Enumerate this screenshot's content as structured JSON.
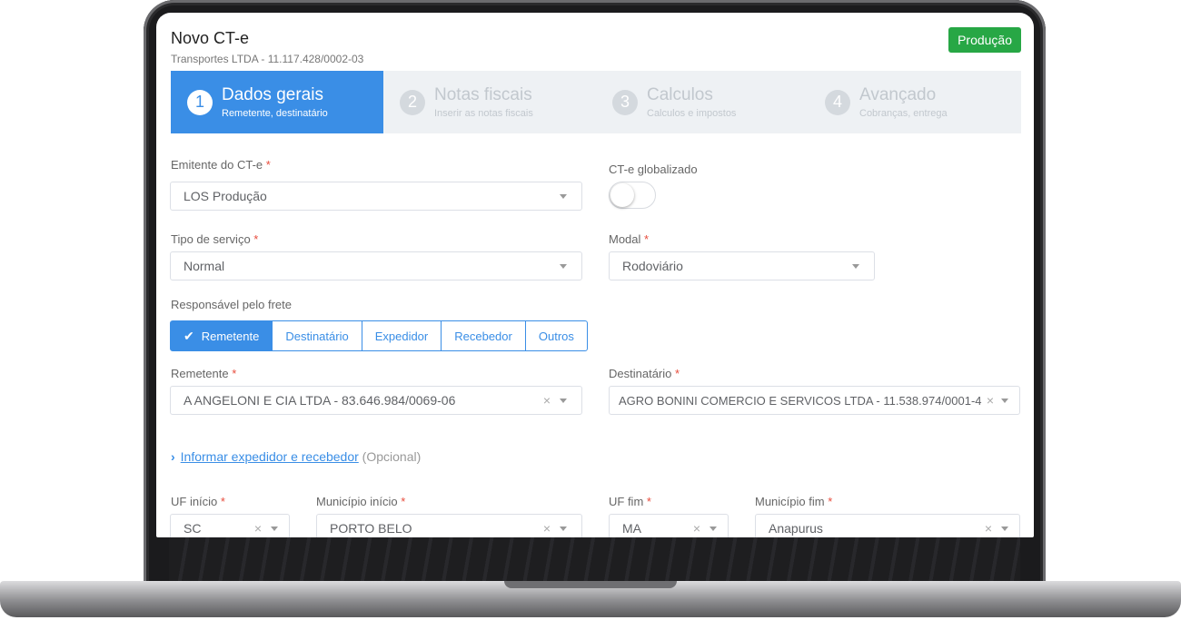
{
  "header": {
    "title": "Novo CT-e",
    "subtitle": "Transportes LTDA - 11.117.428/0002-03",
    "env_badge": "Produção"
  },
  "steps": [
    {
      "num": "1",
      "title": "Dados gerais",
      "desc": "Remetente, destinatário",
      "active": true
    },
    {
      "num": "2",
      "title": "Notas fiscais",
      "desc": "Inserir as notas fiscais",
      "active": false
    },
    {
      "num": "3",
      "title": "Calculos",
      "desc": "Calculos e impostos",
      "active": false
    },
    {
      "num": "4",
      "title": "Avançado",
      "desc": "Cobranças, entrega",
      "active": false
    }
  ],
  "form": {
    "emitente": {
      "label": "Emitente do CT-e",
      "value": "LOS Produção"
    },
    "globalizado": {
      "label": "CT-e globalizado",
      "checked": false
    },
    "tipo_servico": {
      "label": "Tipo de serviço",
      "value": "Normal"
    },
    "modal": {
      "label": "Modal",
      "value": "Rodoviário"
    },
    "responsavel": {
      "label": "Responsável pelo frete",
      "options": [
        "Remetente",
        "Destinatário",
        "Expedidor",
        "Recebedor",
        "Outros"
      ],
      "selected": "Remetente"
    },
    "remetente": {
      "label": "Remetente",
      "value": "A ANGELONI E CIA LTDA - 83.646.984/0069-06"
    },
    "destinatario": {
      "label": "Destinatário",
      "value": "AGRO BONINI COMERCIO E SERVICOS LTDA - 11.538.974/0001-4"
    },
    "expedidor_link": {
      "text": "Informar expedidor e recebedor",
      "suffix": "(Opcional)"
    },
    "uf_inicio": {
      "label": "UF início",
      "value": "SC"
    },
    "municipio_inicio": {
      "label": "Município início",
      "value": "PORTO BELO"
    },
    "uf_fim": {
      "label": "UF fim",
      "value": "MA"
    },
    "municipio_fim": {
      "label": "Município fim",
      "value": "Anapurus"
    }
  },
  "required_mark": "*",
  "icons": {
    "clear": "×",
    "check": "✔",
    "chevron": "›"
  },
  "colors": {
    "primary": "#3a8ee6",
    "success": "#27a745",
    "required": "#e74c3c"
  }
}
